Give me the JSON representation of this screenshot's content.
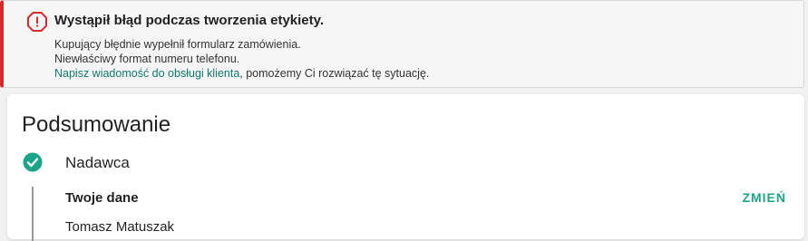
{
  "alert": {
    "title": "Wystąpił błąd podczas tworzenia etykiety.",
    "line1": "Kupujący błędnie wypełnił formularz zamówienia.",
    "line2": "Niewłaściwy format numeru telefonu.",
    "link_text": "Napisz wiadomość do obsługi klienta",
    "line3_rest": ", pomożemy Ci rozwiązać tę sytuację.",
    "icon": "error-octagon-icon",
    "accent_color": "#d92a2a"
  },
  "summary": {
    "title": "Podsumowanie",
    "sender_label": "Nadawca",
    "sender_status_icon": "check-circle-icon",
    "status_color": "#1aa589",
    "your_data_label": "Twoje dane",
    "edit_label": "ZMIEŃ",
    "next_row_partial": "Tomasz Matuszak"
  }
}
